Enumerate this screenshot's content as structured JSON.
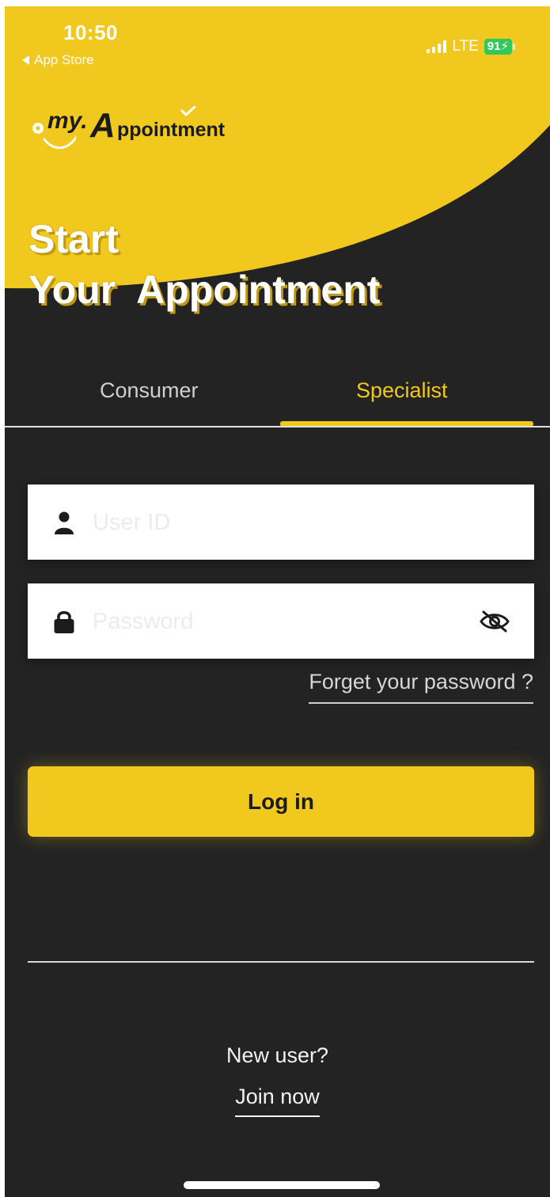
{
  "status_bar": {
    "time": "10:50",
    "back_label": "App Store",
    "network": "LTE",
    "battery": "91"
  },
  "brand": {
    "logo_my": "my.",
    "logo_a": "A",
    "logo_rest": "ppointment"
  },
  "hero": {
    "line1": "Start",
    "line2": "Your  Appointment"
  },
  "tabs": [
    {
      "label": "Consumer",
      "selected": false
    },
    {
      "label": "Specialist",
      "selected": true
    }
  ],
  "form": {
    "user_placeholder": "User ID",
    "user_value": "",
    "password_placeholder": "Password",
    "password_value": "",
    "forgot_label": "Forget your password ?",
    "login_label": "Log in"
  },
  "signup": {
    "prompt": "New user?",
    "join_label": "Join now"
  },
  "colors": {
    "accent": "#f1c81e",
    "background": "#232323",
    "battery": "#34c759"
  }
}
